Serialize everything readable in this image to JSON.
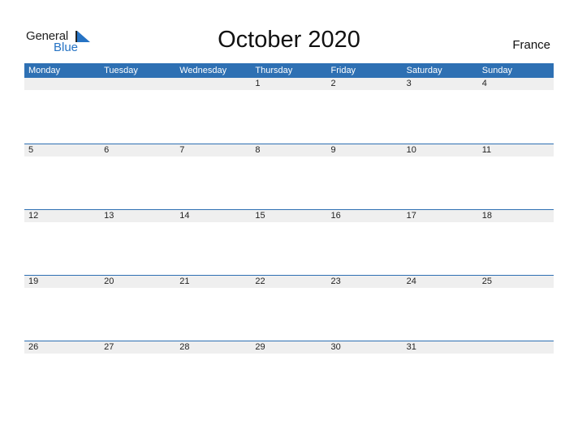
{
  "brand": {
    "general": "General",
    "blue": "Blue",
    "accent": "#2673c4"
  },
  "title": "October 2020",
  "country": "France",
  "header_color": "#2e70b3",
  "weekdays": [
    "Monday",
    "Tuesday",
    "Wednesday",
    "Thursday",
    "Friday",
    "Saturday",
    "Sunday"
  ],
  "weeks": [
    [
      "",
      "",
      "",
      "1",
      "2",
      "3",
      "4"
    ],
    [
      "5",
      "6",
      "7",
      "8",
      "9",
      "10",
      "11"
    ],
    [
      "12",
      "13",
      "14",
      "15",
      "16",
      "17",
      "18"
    ],
    [
      "19",
      "20",
      "21",
      "22",
      "23",
      "24",
      "25"
    ],
    [
      "26",
      "27",
      "28",
      "29",
      "30",
      "31",
      ""
    ]
  ]
}
